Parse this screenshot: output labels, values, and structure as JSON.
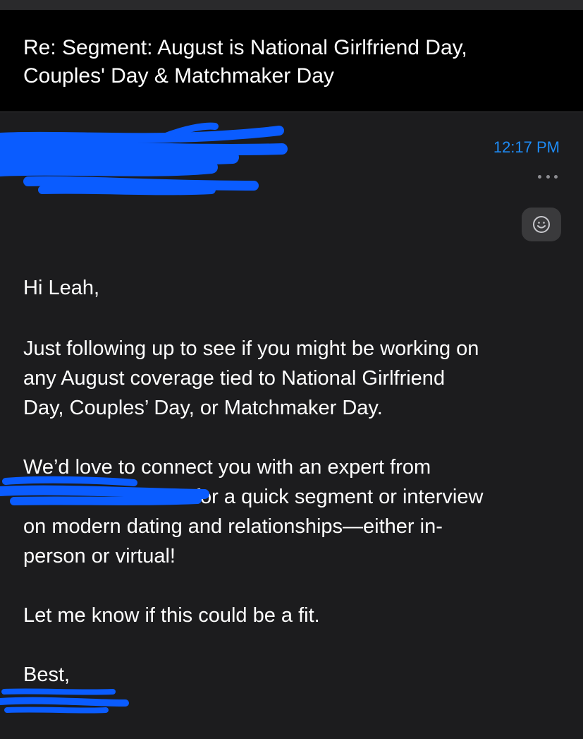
{
  "email": {
    "subject_line_1": "Re: Segment: August is National Girlfriend Day,",
    "subject_line_2": "Couples' Day & Matchmaker Day",
    "time": "12:17 PM",
    "body": {
      "greeting": "Hi Leah,",
      "p1_l1": "Just following up to see if you might be working on",
      "p1_l2": "any August coverage tied to National Girlfriend",
      "p1_l3": "Day, Couples’ Day, or Matchmaker Day.",
      "p2_l1": "We’d love to connect you with an expert from",
      "p2_l2": "for a quick segment or interview",
      "p2_l3": "on modern dating and relationships—either in-",
      "p2_l4": "person or virtual!",
      "p3": "Let me know if this could be a fit.",
      "signoff": "Best,"
    }
  },
  "icons": {
    "more": "ellipsis-icon",
    "reaction": "smiley-icon"
  },
  "colors": {
    "background": "#1c1c1e",
    "header_background": "#000000",
    "accent": "#1e8bf5",
    "redaction": "#0a5cff"
  }
}
